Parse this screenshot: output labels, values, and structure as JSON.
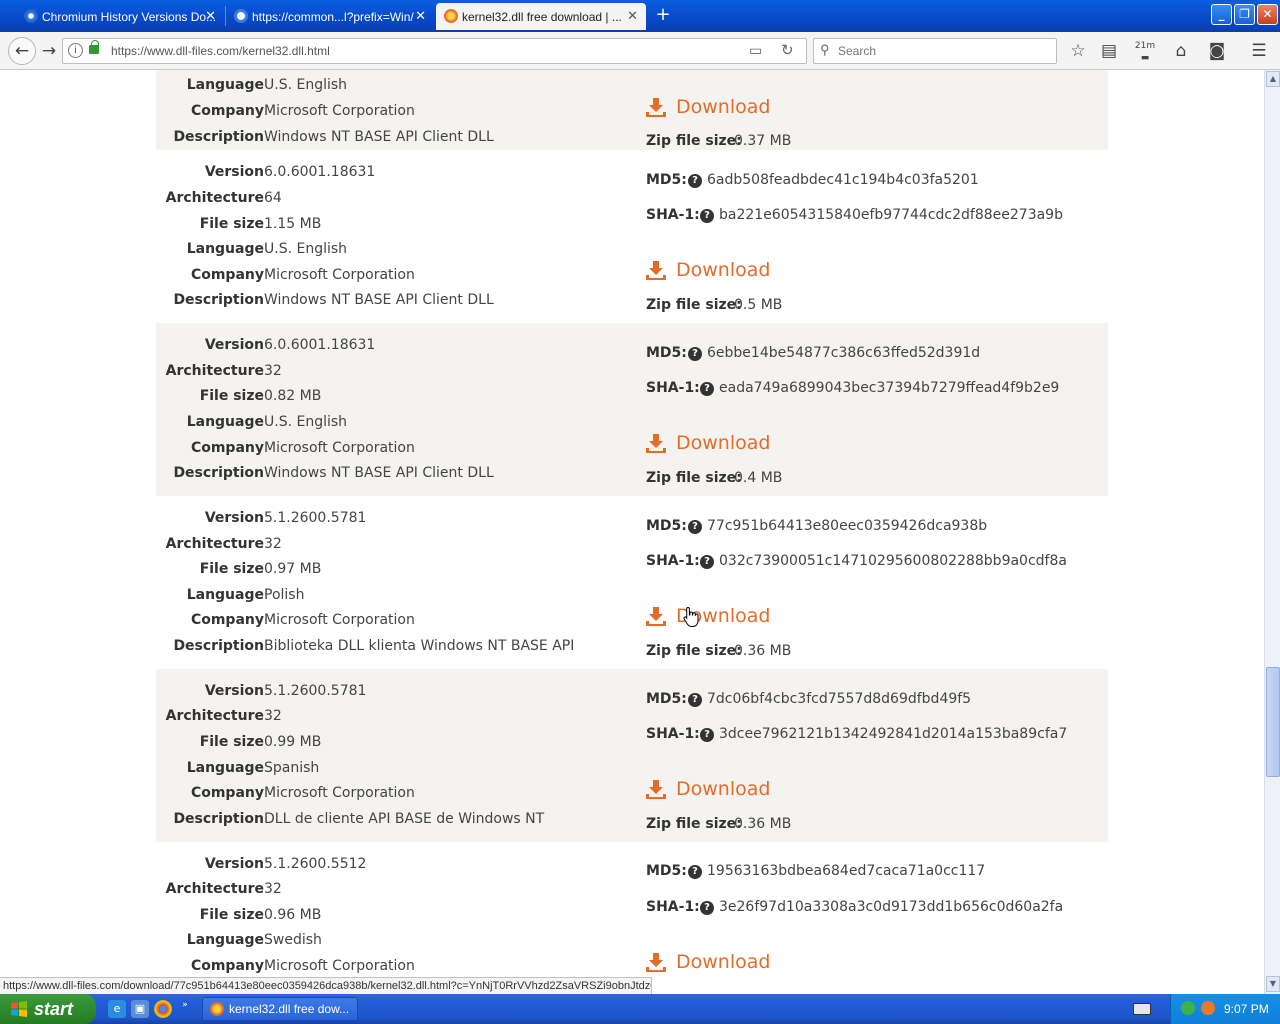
{
  "browser": {
    "tabs": [
      {
        "title": "Chromium History Versions Do...",
        "active": false
      },
      {
        "title": "https://common...l?prefix=Win/",
        "active": false
      },
      {
        "title": "kernel32.dll free download | ...",
        "active": true
      }
    ],
    "url": "https://www.dll-files.com/kernel32.dll.html",
    "search_placeholder": "Search",
    "download_badge": "21m",
    "status_url": "https://www.dll-files.com/download/77c951b64413e80eec0359426dca938b/kernel32.dll.html?c=YnNjT0RrVVhzd2ZsaVRSZi9obnJtdz09"
  },
  "labels": {
    "version": "Version",
    "architecture": "Architecture",
    "file_size": "File size",
    "language": "Language",
    "company": "Company",
    "description": "Description",
    "md5": "MD5:",
    "sha1": "SHA-1:",
    "download": "Download",
    "zip_size": "Zip file size:"
  },
  "partial_entry": {
    "language": "U.S. English",
    "company": "Microsoft Corporation",
    "description": "Windows NT BASE API Client DLL",
    "zip_size": "0.37 MB"
  },
  "entries": [
    {
      "version": "6.0.6001.18631",
      "architecture": "64",
      "file_size": "1.15 MB",
      "language": "U.S. English",
      "company": "Microsoft Corporation",
      "description": "Windows NT BASE API Client DLL",
      "md5": "6adb508feadbdec41c194b4c03fa5201",
      "sha1": "ba221e6054315840efb97744cdc2df88ee273a9b",
      "zip_size": "0.5 MB"
    },
    {
      "version": "6.0.6001.18631",
      "architecture": "32",
      "file_size": "0.82 MB",
      "language": "U.S. English",
      "company": "Microsoft Corporation",
      "description": "Windows NT BASE API Client DLL",
      "md5": "6ebbe14be54877c386c63ffed52d391d",
      "sha1": "eada749a6899043bec37394b7279ffead4f9b2e9",
      "zip_size": "0.4 MB"
    },
    {
      "version": "5.1.2600.5781",
      "architecture": "32",
      "file_size": "0.97 MB",
      "language": "Polish",
      "company": "Microsoft Corporation",
      "description": "Biblioteka DLL klienta Windows NT BASE API",
      "md5": "77c951b64413e80eec0359426dca938b",
      "sha1": "032c73900051c14710295600802288bb9a0cdf8a",
      "zip_size": "0.36 MB"
    },
    {
      "version": "5.1.2600.5781",
      "architecture": "32",
      "file_size": "0.99 MB",
      "language": "Spanish",
      "company": "Microsoft Corporation",
      "description": "DLL de cliente API BASE de Windows NT",
      "md5": "7dc06bf4cbc3fcd7557d8d69dfbd49f5",
      "sha1": "3dcee7962121b1342492841d2014a153ba89cfa7",
      "zip_size": "0.36 MB"
    },
    {
      "version": "5.1.2600.5512",
      "architecture": "32",
      "file_size": "0.96 MB",
      "language": "Swedish",
      "company": "Microsoft Corporation",
      "md5": "19563163bdbea684ed7caca71a0cc117",
      "sha1": "3e26f97d10a3308a3c0d9173dd1b656c0d60a2fa"
    }
  ],
  "taskbar": {
    "start_label": "start",
    "task_title": "kernel32.dll free dow...",
    "clock": "9:07 PM"
  },
  "colors": {
    "accent_orange": "#e36c2a",
    "row_shade": "#f4f3f0",
    "xp_blue": "#245edb"
  }
}
